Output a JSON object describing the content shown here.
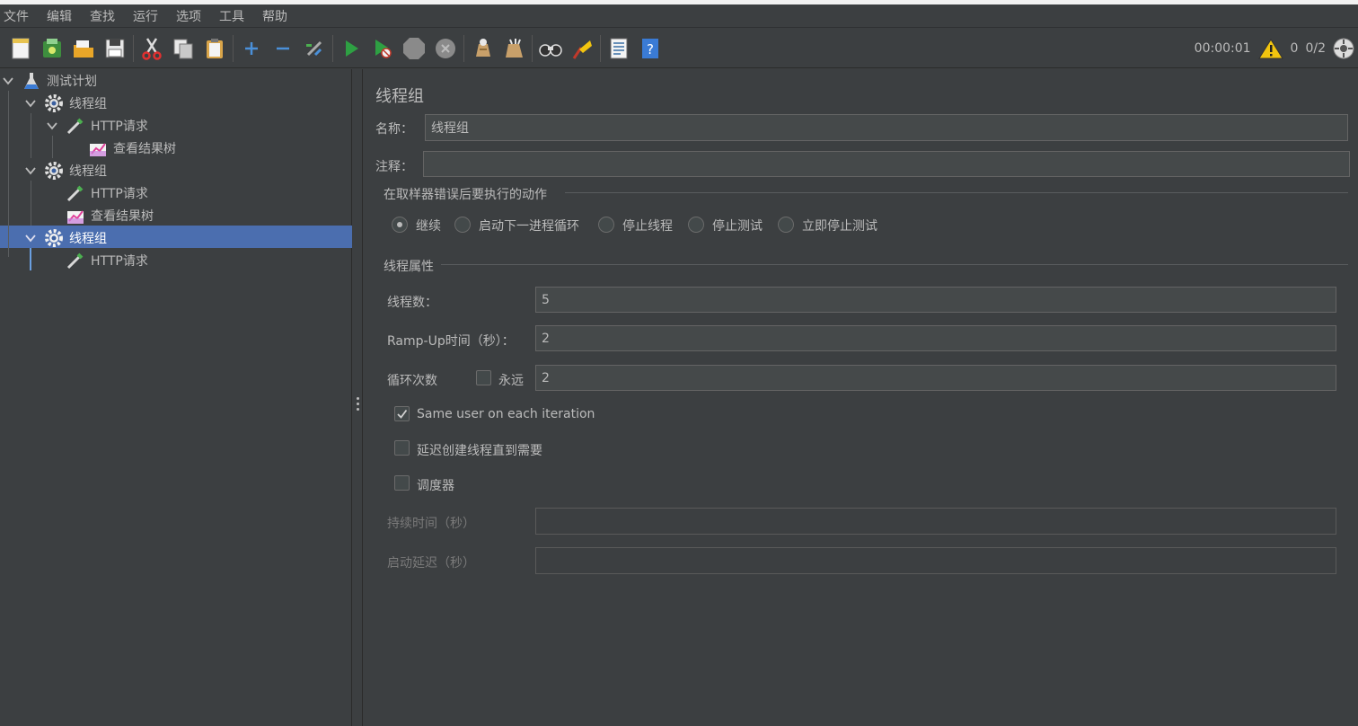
{
  "menu": [
    "文件",
    "编辑",
    "查找",
    "运行",
    "选项",
    "工具",
    "帮助"
  ],
  "status": {
    "elapsed": "00:00:01",
    "warnings": "0",
    "threads": "0/2"
  },
  "tree": {
    "nodes": [
      {
        "label": "测试计划"
      },
      {
        "label": "线程组"
      },
      {
        "label": "HTTP请求"
      },
      {
        "label": "查看结果树"
      },
      {
        "label": "线程组"
      },
      {
        "label": "HTTP请求"
      },
      {
        "label": "查看结果树"
      },
      {
        "label": "线程组"
      },
      {
        "label": "HTTP请求"
      }
    ]
  },
  "form": {
    "title": "线程组",
    "name_label": "名称：",
    "name_value": "线程组",
    "comment_label": "注释：",
    "comment_value": "",
    "error_group_title": "在取样器错误后要执行的动作",
    "error_actions": [
      {
        "label": "继续",
        "selected": true
      },
      {
        "label": "启动下一进程循环",
        "selected": false
      },
      {
        "label": "停止线程",
        "selected": false
      },
      {
        "label": "停止测试",
        "selected": false
      },
      {
        "label": "立即停止测试",
        "selected": false
      }
    ],
    "thread_group_title": "线程属性",
    "threads_label": "线程数：",
    "threads_value": "5",
    "rampup_label": "Ramp-Up时间（秒）：",
    "rampup_value": "2",
    "loop_label": "循环次数",
    "forever_label": "永远",
    "forever_checked": false,
    "loop_value": "2",
    "same_user_label": "Same user on each iteration",
    "same_user_checked": true,
    "delay_create_label": "延迟创建线程直到需要",
    "delay_create_checked": false,
    "scheduler_label": "调度器",
    "scheduler_checked": false,
    "duration_label": "持续时间（秒）",
    "duration_value": "",
    "startup_delay_label": "启动延迟（秒）",
    "startup_delay_value": ""
  }
}
